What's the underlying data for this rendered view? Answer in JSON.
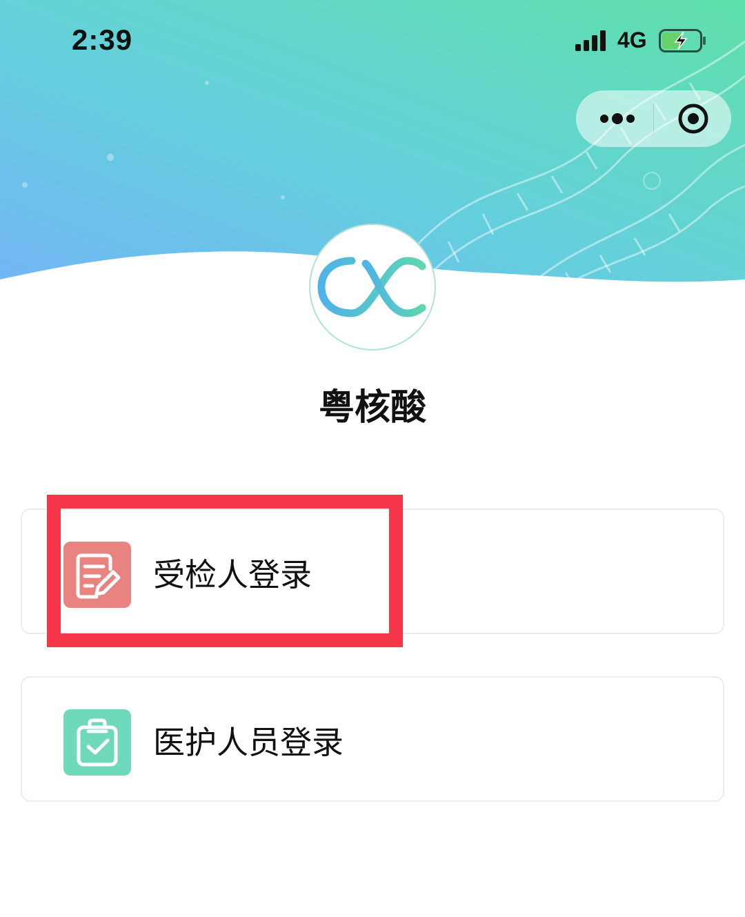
{
  "status_bar": {
    "time": "2:39",
    "network": "4G",
    "icons": [
      "signal-icon",
      "battery-charging-icon"
    ]
  },
  "capsule": {
    "icons": [
      "more-icon",
      "close-target-icon"
    ]
  },
  "app": {
    "name": "粤核酸",
    "logo": "dna-logo-icon"
  },
  "login_options": [
    {
      "label": "受检人登录",
      "icon": "form-edit-icon",
      "color": "#e98380"
    },
    {
      "label": "医护人员登录",
      "icon": "clipboard-check-icon",
      "color": "#6fdabb"
    }
  ],
  "highlight_color": "#f6374a"
}
